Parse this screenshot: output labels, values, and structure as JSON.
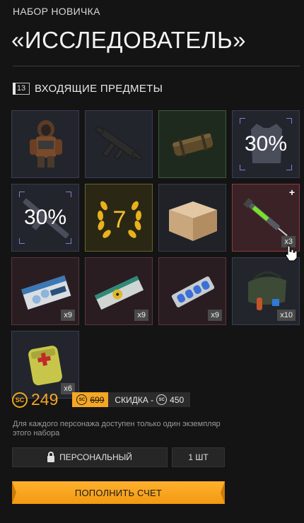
{
  "header": {
    "subtitle": "НАБОР НОВИЧКА",
    "title": "«ИССЛЕДОВАТЕЛЬ»"
  },
  "section": {
    "count": "13",
    "label": "ВХОДЯЩИЕ ПРЕДМЕТЫ"
  },
  "items": [
    {
      "name": "armor-suit",
      "qty": ""
    },
    {
      "name": "submachine-gun",
      "qty": ""
    },
    {
      "name": "container",
      "qty": ""
    },
    {
      "name": "armor-discount",
      "pct": "30%"
    },
    {
      "name": "weapon-discount",
      "pct": "30%"
    },
    {
      "name": "rank-badge",
      "value": "7"
    },
    {
      "name": "supply-box",
      "qty": ""
    },
    {
      "name": "syringe",
      "qty": "x3"
    },
    {
      "name": "medicine-pack",
      "qty": "x9"
    },
    {
      "name": "anti-rad-pack",
      "qty": "x9"
    },
    {
      "name": "pills-blister",
      "qty": "x9"
    },
    {
      "name": "grenade-bag",
      "qty": "x10"
    },
    {
      "name": "medkit",
      "qty": "x6"
    }
  ],
  "pricing": {
    "currency_icon": "SC",
    "price": "249",
    "old_price": "699",
    "discount_label": "СКИДКА -",
    "discount_value": "450"
  },
  "note": "Для каждого персонажа доступен только один экземпляр этого набора",
  "buttons": {
    "personal": "ПЕРСОНАЛЬНЫЙ",
    "quantity": "1 ШТ",
    "top_up": "ПОПОЛНИТЬ СЧЕТ"
  },
  "colors": {
    "accent": "#f5a623",
    "background": "#141414"
  }
}
